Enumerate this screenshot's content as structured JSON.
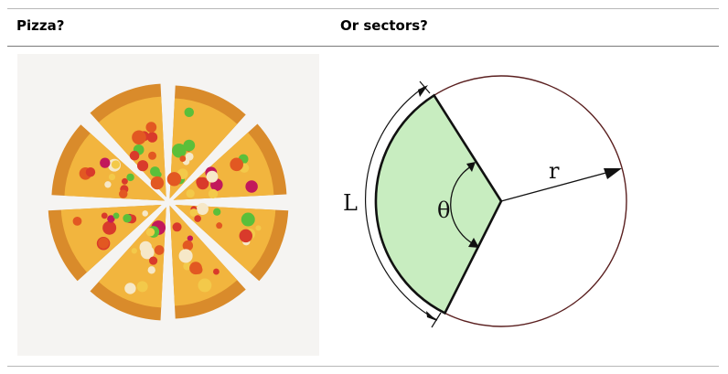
{
  "header": {
    "left": "Pizza?",
    "right": "Or sectors?"
  },
  "pizza": {
    "slices": 8
  },
  "diagram": {
    "labels": {
      "arc_length": "L",
      "angle": "θ",
      "radius": "r"
    },
    "colors": {
      "sector_fill": "#c8edc0",
      "circle_stroke": "#5a1f1f",
      "sector_stroke": "#111111"
    }
  }
}
